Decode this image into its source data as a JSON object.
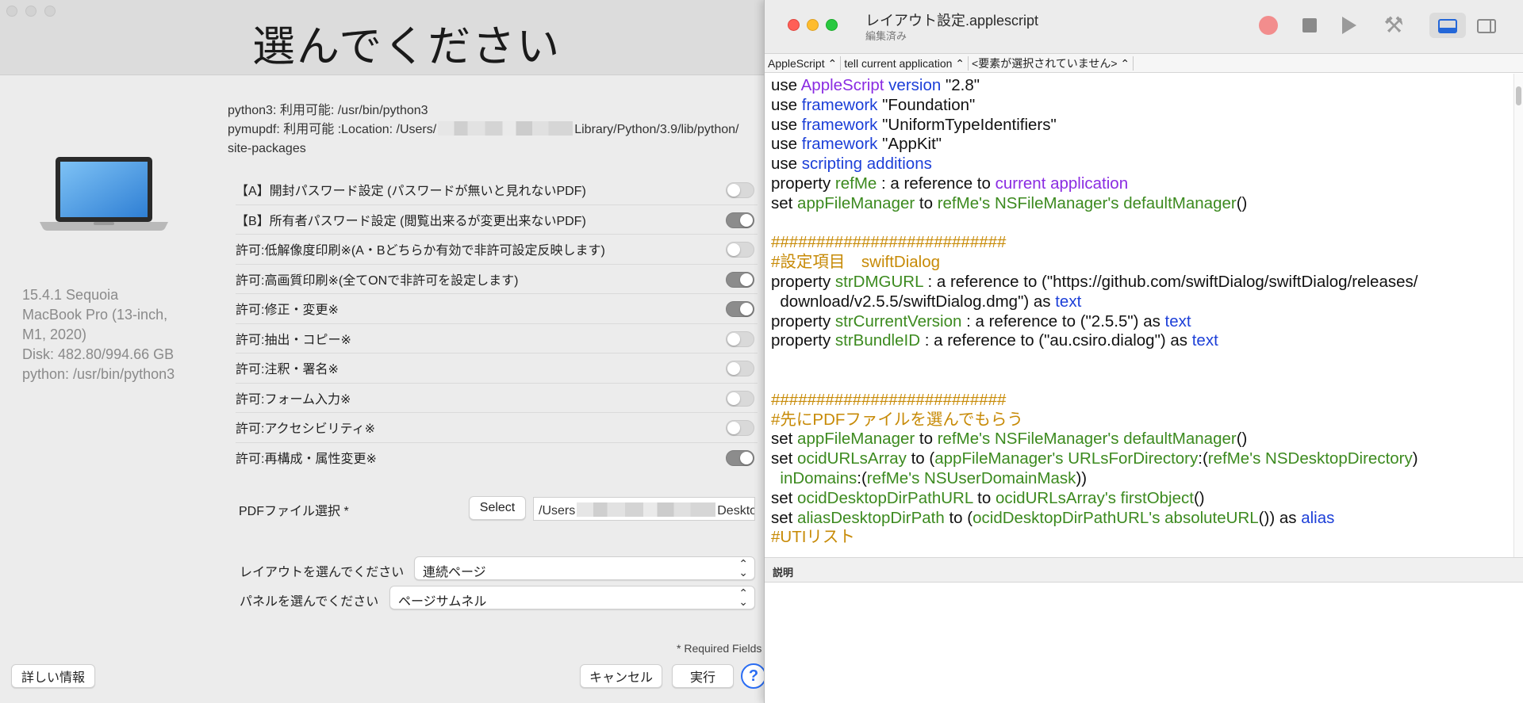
{
  "dialog": {
    "title": "選んでください",
    "sysinfo": [
      "15.4.1 Sequoia",
      "MacBook Pro (13-inch,",
      "M1, 2020)",
      "Disk: 482.80/994.66 GB",
      "python: /usr/bin/python3"
    ],
    "python_line": "python3: 利用可能: /usr/bin/python3",
    "pymupdf_prefix": "pymupdf: 利用可能 :Location: /Users/",
    "pymupdf_suffix": "Library/Python/3.9/lib/python/",
    "pymupdf_line2": "site-packages",
    "toggles": [
      {
        "label": "【A】開封パスワード設定 (パスワードが無いと見れないPDF)",
        "on": false
      },
      {
        "label": "【B】所有者パスワード設定 (閲覧出来るが変更出来ないPDF)",
        "on": true
      },
      {
        "label": "許可:低解像度印刷※(A・Bどちらか有効で非許可設定反映します)",
        "on": false
      },
      {
        "label": "許可:高画質印刷※(全てONで非許可を設定します)",
        "on": true
      },
      {
        "label": "許可:修正・変更※",
        "on": true
      },
      {
        "label": "許可:抽出・コピー※",
        "on": false
      },
      {
        "label": "許可:注釈・署名※",
        "on": false
      },
      {
        "label": "許可:フォーム入力※",
        "on": false
      },
      {
        "label": "許可:アクセシビリティ※",
        "on": false
      },
      {
        "label": "許可:再構成・属性変更※",
        "on": true
      }
    ],
    "pdf_label": "PDFファイル選択 *",
    "select_label": "Select",
    "path_prefix": "/Users",
    "path_suffix": "Deskto",
    "layout_label": "レイアウトを選んでください",
    "layout_value": "連続ページ",
    "panel_label": "パネルを選んでください",
    "panel_value": "ページサムネル",
    "required": "* Required Fields",
    "details": "詳しい情報",
    "cancel": "キャンセル",
    "run": "実行",
    "help": "?"
  },
  "editor": {
    "title": "レイアウト設定.applescript",
    "subtitle": "編集済み",
    "nav": [
      "AppleScript ⌃",
      "tell current application ⌃",
      "<要素が選択されていません> ⌃"
    ],
    "description_label": "説明",
    "code": [
      [
        [
          "kw",
          "use "
        ],
        [
          "cls",
          "AppleScript"
        ],
        [
          "blu",
          " version"
        ],
        [
          "kw",
          " \"2.8\""
        ]
      ],
      [
        [
          "kw",
          "use "
        ],
        [
          "blu",
          "framework"
        ],
        [
          "kw",
          " \"Foundation\""
        ]
      ],
      [
        [
          "kw",
          "use "
        ],
        [
          "blu",
          "framework"
        ],
        [
          "kw",
          " \"UniformTypeIdentifiers\""
        ]
      ],
      [
        [
          "kw",
          "use "
        ],
        [
          "blu",
          "framework"
        ],
        [
          "kw",
          " \"AppKit\""
        ]
      ],
      [
        [
          "kw",
          "use "
        ],
        [
          "blu",
          "scripting additions"
        ]
      ],
      [
        [
          "kw",
          "property "
        ],
        [
          "var",
          "refMe"
        ],
        [
          "kw",
          " : a reference to "
        ],
        [
          "cls",
          "current application"
        ]
      ],
      [
        [
          "kw",
          "set "
        ],
        [
          "var",
          "appFileManager"
        ],
        [
          "kw",
          " to "
        ],
        [
          "var",
          "refMe's NSFileManager's defaultManager"
        ],
        [
          "kw",
          "()"
        ]
      ],
      [],
      [
        [
          "cmt",
          "##########################"
        ]
      ],
      [
        [
          "cmt",
          "#設定項目　swiftDialog"
        ]
      ],
      [
        [
          "kw",
          "property "
        ],
        [
          "var",
          "strDMGURL"
        ],
        [
          "kw",
          " : a reference to (\"https://github.com/swiftDialog/swiftDialog/releases/"
        ]
      ],
      [
        [
          "kw",
          "  download/v2.5.5/swiftDialog.dmg\") as "
        ],
        [
          "blu",
          "text"
        ]
      ],
      [
        [
          "kw",
          "property "
        ],
        [
          "var",
          "strCurrentVersion"
        ],
        [
          "kw",
          " : a reference to (\"2.5.5\") as "
        ],
        [
          "blu",
          "text"
        ]
      ],
      [
        [
          "kw",
          "property "
        ],
        [
          "var",
          "strBundleID"
        ],
        [
          "kw",
          " : a reference to (\"au.csiro.dialog\") as "
        ],
        [
          "blu",
          "text"
        ]
      ],
      [],
      [],
      [
        [
          "cmt",
          "##########################"
        ]
      ],
      [
        [
          "cmt",
          "#先にPDFファイルを選んでもらう"
        ]
      ],
      [
        [
          "kw",
          "set "
        ],
        [
          "var",
          "appFileManager"
        ],
        [
          "kw",
          " to "
        ],
        [
          "var",
          "refMe's NSFileManager's defaultManager"
        ],
        [
          "kw",
          "()"
        ]
      ],
      [
        [
          "kw",
          "set "
        ],
        [
          "var",
          "ocidURLsArray"
        ],
        [
          "kw",
          " to ("
        ],
        [
          "var",
          "appFileManager's URLsForDirectory"
        ],
        [
          "kw",
          ":("
        ],
        [
          "var",
          "refMe's NSDesktopDirectory"
        ],
        [
          "kw",
          ")"
        ]
      ],
      [
        [
          "kw",
          "  "
        ],
        [
          "var",
          "inDomains"
        ],
        [
          "kw",
          ":("
        ],
        [
          "var",
          "refMe's NSUserDomainMask"
        ],
        [
          "kw",
          "))"
        ]
      ],
      [
        [
          "kw",
          "set "
        ],
        [
          "var",
          "ocidDesktopDirPathURL"
        ],
        [
          "kw",
          " to "
        ],
        [
          "var",
          "ocidURLsArray's firstObject"
        ],
        [
          "kw",
          "()"
        ]
      ],
      [
        [
          "kw",
          "set "
        ],
        [
          "var",
          "aliasDesktopDirPath"
        ],
        [
          "kw",
          " to ("
        ],
        [
          "var",
          "ocidDesktopDirPathURL's absoluteURL"
        ],
        [
          "kw",
          "()) as "
        ],
        [
          "blu",
          "alias"
        ]
      ],
      [
        [
          "cmt",
          "#UTIリスト"
        ]
      ]
    ]
  }
}
